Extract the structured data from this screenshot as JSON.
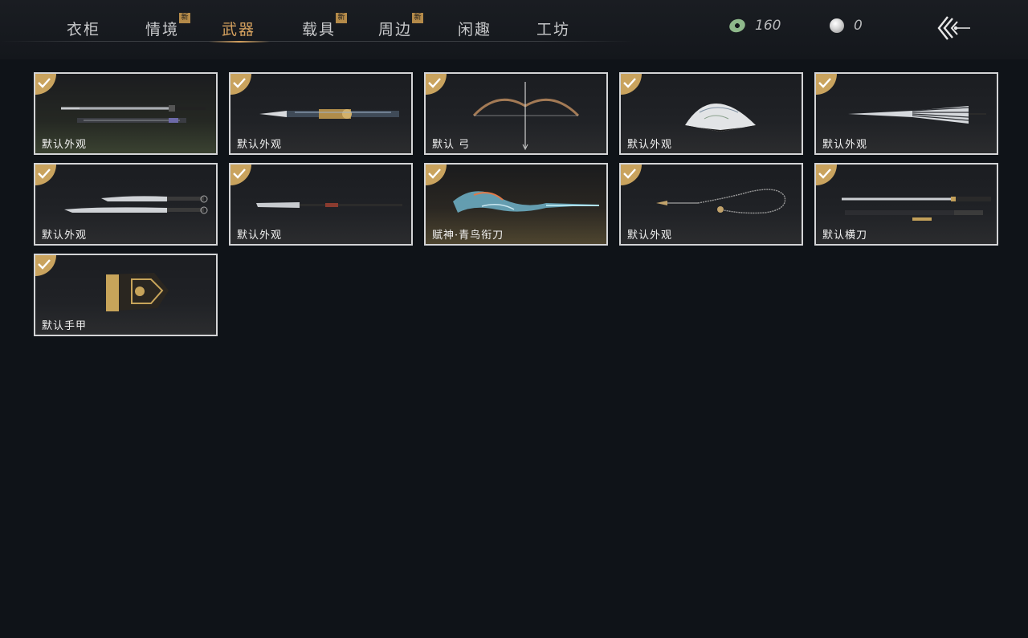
{
  "tabs": [
    {
      "label": "衣柜",
      "badge": ""
    },
    {
      "label": "情境",
      "badge": "新"
    },
    {
      "label": "武器",
      "badge": ""
    },
    {
      "label": "载具",
      "badge": "新"
    },
    {
      "label": "周边",
      "badge": "新"
    },
    {
      "label": "闲趣",
      "badge": ""
    },
    {
      "label": "工坊",
      "badge": ""
    }
  ],
  "active_tab": "武器",
  "currency": {
    "jade": {
      "icon": "jade-coin-icon",
      "value": "160"
    },
    "pearl": {
      "icon": "pearl-icon",
      "value": "0"
    }
  },
  "back_icon": "back-arrow-icon",
  "items": [
    {
      "label": "默认外观",
      "icon": "twin-swords-icon",
      "equipped": true
    },
    {
      "label": "默认外观",
      "icon": "ornate-spear-icon",
      "equipped": true
    },
    {
      "label": "默认 弓",
      "icon": "bow-icon",
      "equipped": true
    },
    {
      "label": "默认外观",
      "icon": "folding-fan-icon",
      "equipped": true
    },
    {
      "label": "默认外观",
      "icon": "umbrella-icon",
      "equipped": true
    },
    {
      "label": "默认外观",
      "icon": "dual-blades-icon",
      "equipped": true
    },
    {
      "label": "默认外观",
      "icon": "glaive-icon",
      "equipped": true
    },
    {
      "label": "赋神·青鸟衔刀",
      "icon": "azure-bird-blade-icon",
      "equipped": true
    },
    {
      "label": "默认外观",
      "icon": "rope-dart-icon",
      "equipped": true
    },
    {
      "label": "默认横刀",
      "icon": "hengdao-icon",
      "equipped": true
    },
    {
      "label": "默认手甲",
      "icon": "gauntlet-icon",
      "equipped": true
    }
  ],
  "colors": {
    "accent": "#d6a25f",
    "background": "#0f1318",
    "card_border": "#d3d4d6",
    "check_gold": "#c9a35e"
  }
}
